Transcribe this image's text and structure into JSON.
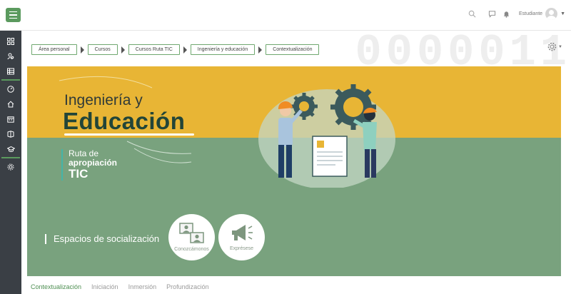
{
  "navbar": {
    "user_name": "Estudiante"
  },
  "sidebar": {
    "items": [
      {
        "icon": "dashboard-grid-icon"
      },
      {
        "icon": "user-search-icon"
      },
      {
        "icon": "table-icon"
      },
      {
        "icon": "speedometer-icon"
      },
      {
        "icon": "home-icon"
      },
      {
        "icon": "calendar-icon"
      },
      {
        "icon": "files-icon"
      },
      {
        "icon": "graduation-cap-icon"
      },
      {
        "icon": "settings-icon"
      }
    ]
  },
  "breadcrumb": [
    "Área personal",
    "Cursos",
    "Cursos Ruta TIC",
    "Ingeniería y educación",
    "Contextualización"
  ],
  "background_digits": "0000011",
  "banner": {
    "title_line1": "Ingeniería y",
    "title_line2": "Educación",
    "ruta_line1": "Ruta de",
    "ruta_line2": "apropiación",
    "ruta_line3": "TIC",
    "espacios": "Espacios de socialización",
    "buttons": [
      {
        "label": "Conozcámonos",
        "icon": "people-cards-icon"
      },
      {
        "label": "Exprésese",
        "icon": "megaphone-icon"
      }
    ]
  },
  "tabs": [
    "Contextualización",
    "Iniciación",
    "Inmersión",
    "Profundización"
  ],
  "colors": {
    "accent_green": "#5b9a5e",
    "banner_yellow": "#e8b535",
    "banner_green": "#79a27e",
    "sidebar_dark": "#3a3f45",
    "title_dark_green": "#224538"
  }
}
